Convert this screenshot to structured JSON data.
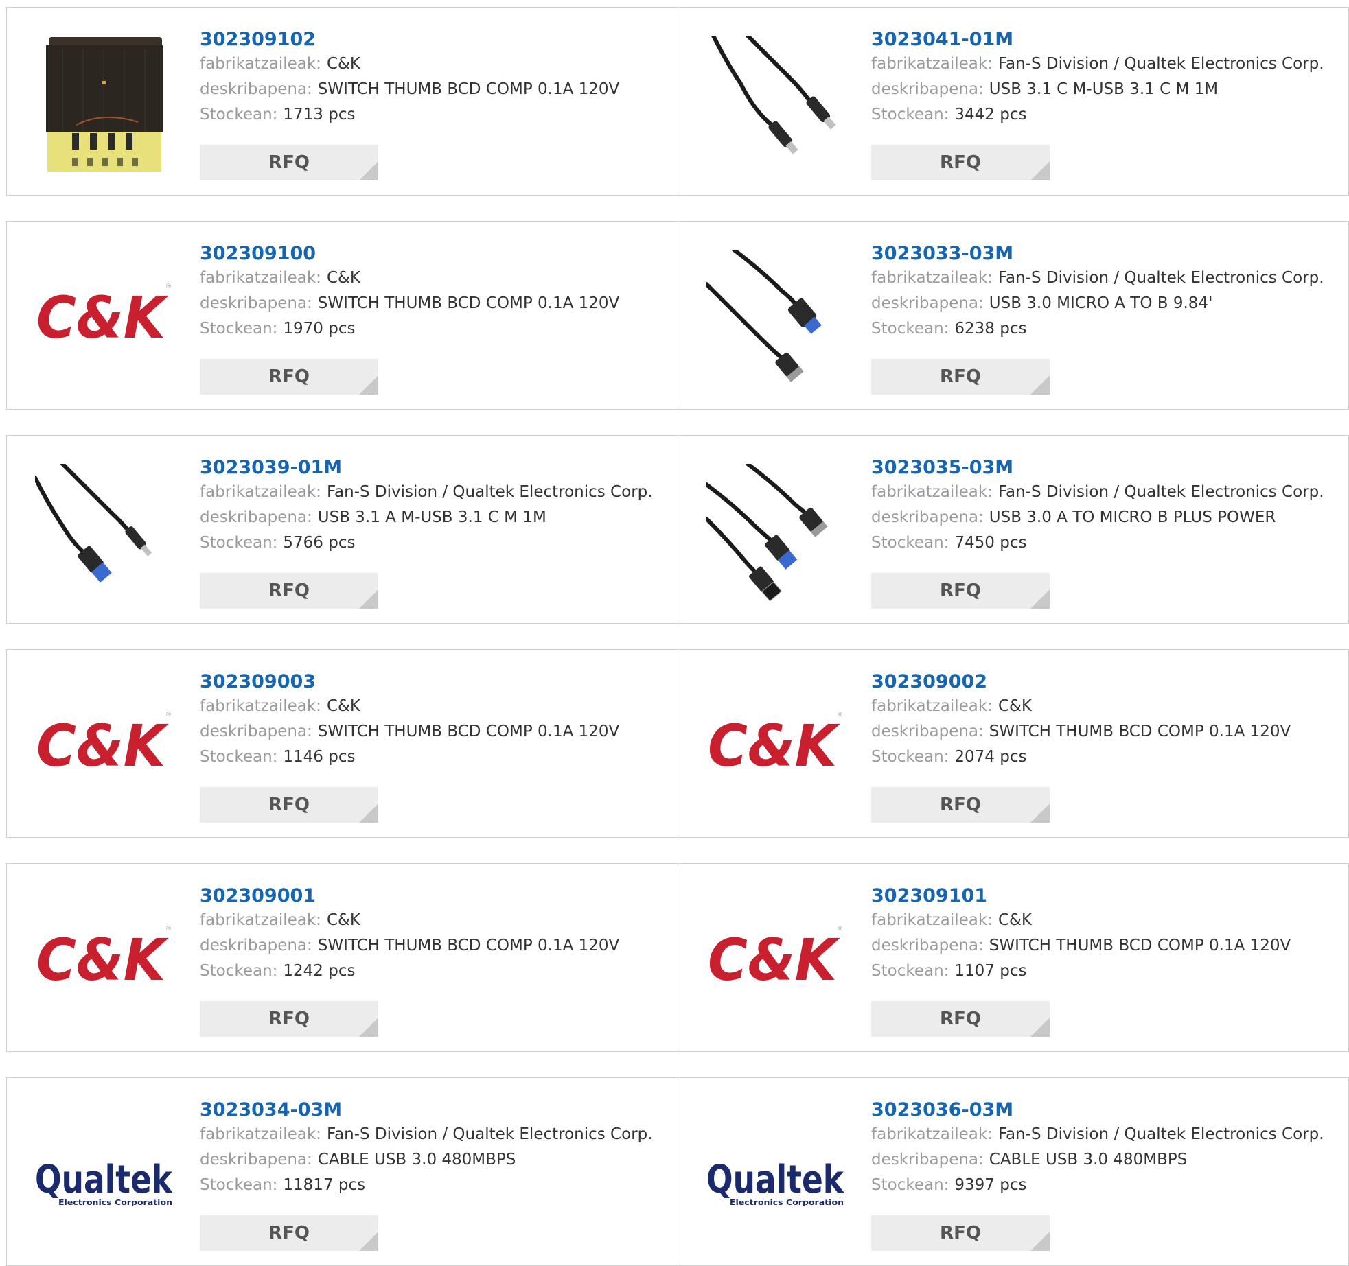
{
  "labels": {
    "manufacturer": "fabrikatzaileak:",
    "description": "deskribapena:",
    "stock": "Stockean:",
    "rfq": "RFQ"
  },
  "products": [
    {
      "part": "302309102",
      "manufacturer": "C&K",
      "description": "SWITCH THUMB BCD COMP 0.1A 120V",
      "stock": "1713 pcs",
      "image": "thumbwheel-switch-photo"
    },
    {
      "part": "3023041-01M",
      "manufacturer": "Fan-S Division / Qualtek Electronics Corp.",
      "description": "USB 3.1 C M-USB 3.1 C M 1M",
      "stock": "3442 pcs",
      "image": "usb-c-cable-photo"
    },
    {
      "part": "302309100",
      "manufacturer": "C&K",
      "description": "SWITCH THUMB BCD COMP 0.1A 120V",
      "stock": "1970 pcs",
      "image": "ck-logo",
      "logo_text": "C&K"
    },
    {
      "part": "3023033-03M",
      "manufacturer": "Fan-S Division / Qualtek Electronics Corp.",
      "description": "USB 3.0 MICRO A TO B 9.84'",
      "stock": "6238 pcs",
      "image": "usb-micro-cable-photo"
    },
    {
      "part": "3023039-01M",
      "manufacturer": "Fan-S Division / Qualtek Electronics Corp.",
      "description": "USB 3.1 A M-USB 3.1 C M 1M",
      "stock": "5766 pcs",
      "image": "usb-a-to-c-cable-photo"
    },
    {
      "part": "3023035-03M",
      "manufacturer": "Fan-S Division / Qualtek Electronics Corp.",
      "description": "USB 3.0 A TO MICRO B PLUS POWER",
      "stock": "7450 pcs",
      "image": "usb-y-cable-photo"
    },
    {
      "part": "302309003",
      "manufacturer": "C&K",
      "description": "SWITCH THUMB BCD COMP 0.1A 120V",
      "stock": "1146 pcs",
      "image": "ck-logo",
      "logo_text": "C&K"
    },
    {
      "part": "302309002",
      "manufacturer": "C&K",
      "description": "SWITCH THUMB BCD COMP 0.1A 120V",
      "stock": "2074 pcs",
      "image": "ck-logo",
      "logo_text": "C&K"
    },
    {
      "part": "302309001",
      "manufacturer": "C&K",
      "description": "SWITCH THUMB BCD COMP 0.1A 120V",
      "stock": "1242 pcs",
      "image": "ck-logo",
      "logo_text": "C&K"
    },
    {
      "part": "302309101",
      "manufacturer": "C&K",
      "description": "SWITCH THUMB BCD COMP 0.1A 120V",
      "stock": "1107 pcs",
      "image": "ck-logo",
      "logo_text": "C&K"
    },
    {
      "part": "3023034-03M",
      "manufacturer": "Fan-S Division / Qualtek Electronics Corp.",
      "description": "CABLE USB 3.0 480MBPS",
      "stock": "11817 pcs",
      "image": "qualtek-logo",
      "logo_text": "Qualtek",
      "logo_subtext": "Electronics Corporation"
    },
    {
      "part": "3023036-03M",
      "manufacturer": "Fan-S Division / Qualtek Electronics Corp.",
      "description": "CABLE USB 3.0 480MBPS",
      "stock": "9397 pcs",
      "image": "qualtek-logo",
      "logo_text": "Qualtek",
      "logo_subtext": "Electronics Corporation"
    }
  ],
  "colors": {
    "link": "#1565b0",
    "label": "#9a9a9a",
    "value": "#333333",
    "button_bg": "#ececec",
    "ck_red": "#c8202f",
    "qualtek_navy": "#1a2a6c"
  }
}
